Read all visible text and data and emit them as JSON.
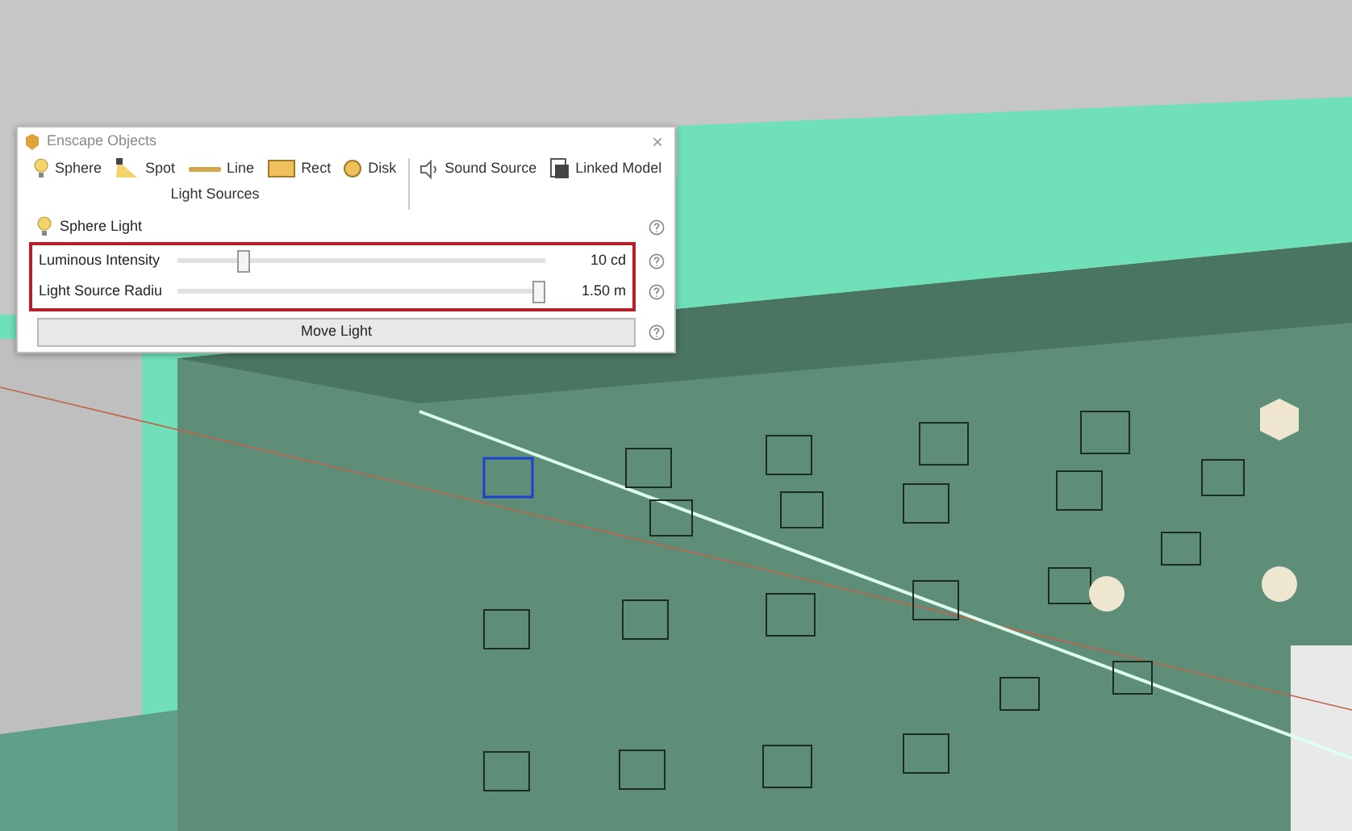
{
  "window": {
    "title": "Enscape Objects",
    "close": "×"
  },
  "toolbar": {
    "groups": [
      {
        "caption": "Light Sources",
        "items": [
          {
            "kind": "sphere",
            "label": "Sphere"
          },
          {
            "kind": "spot",
            "label": "Spot"
          },
          {
            "kind": "line",
            "label": "Line"
          },
          {
            "kind": "rect",
            "label": "Rect"
          },
          {
            "kind": "disk",
            "label": "Disk"
          }
        ]
      },
      {
        "items": [
          {
            "kind": "sound",
            "label": "Sound Source"
          },
          {
            "kind": "linked",
            "label": "Linked Model"
          }
        ]
      }
    ]
  },
  "panel": {
    "title": "Sphere Light",
    "sliders": [
      {
        "label": "Luminous Intensity",
        "level": 0.17,
        "reading": "10 cd"
      },
      {
        "label": "Light Source Radiu",
        "level": 1.0,
        "reading": "1.50 m"
      }
    ],
    "button": "Move Light"
  }
}
